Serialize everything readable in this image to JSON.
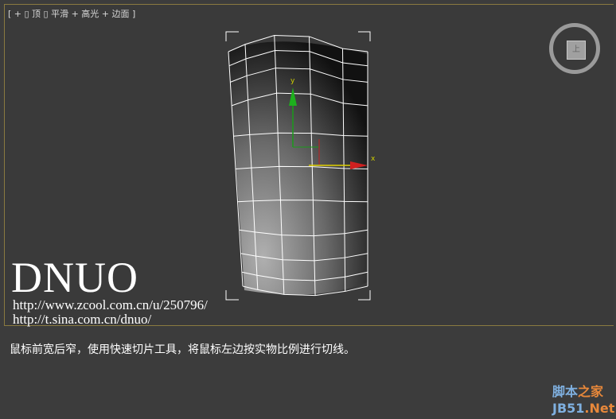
{
  "viewport": {
    "label": "[ + ▯ 顶 ▯ 平滑 + 高光 + 边面 ]",
    "axis_x": "x",
    "axis_y": "y",
    "viewcube_face": "上"
  },
  "overlay": {
    "logo": "DNUO",
    "url1": "http://www.zcool.com.cn/u/250796/",
    "url2": "http://t.sina.com.cn/dnuo/"
  },
  "caption": "鼠标前宽后窄，使用快速切片工具，将鼠标左边按实物比例进行切线。",
  "watermark": {
    "line1a": "脚本",
    "line1b": "之家",
    "line2a": "JB51",
    "line2b": ".Net"
  }
}
